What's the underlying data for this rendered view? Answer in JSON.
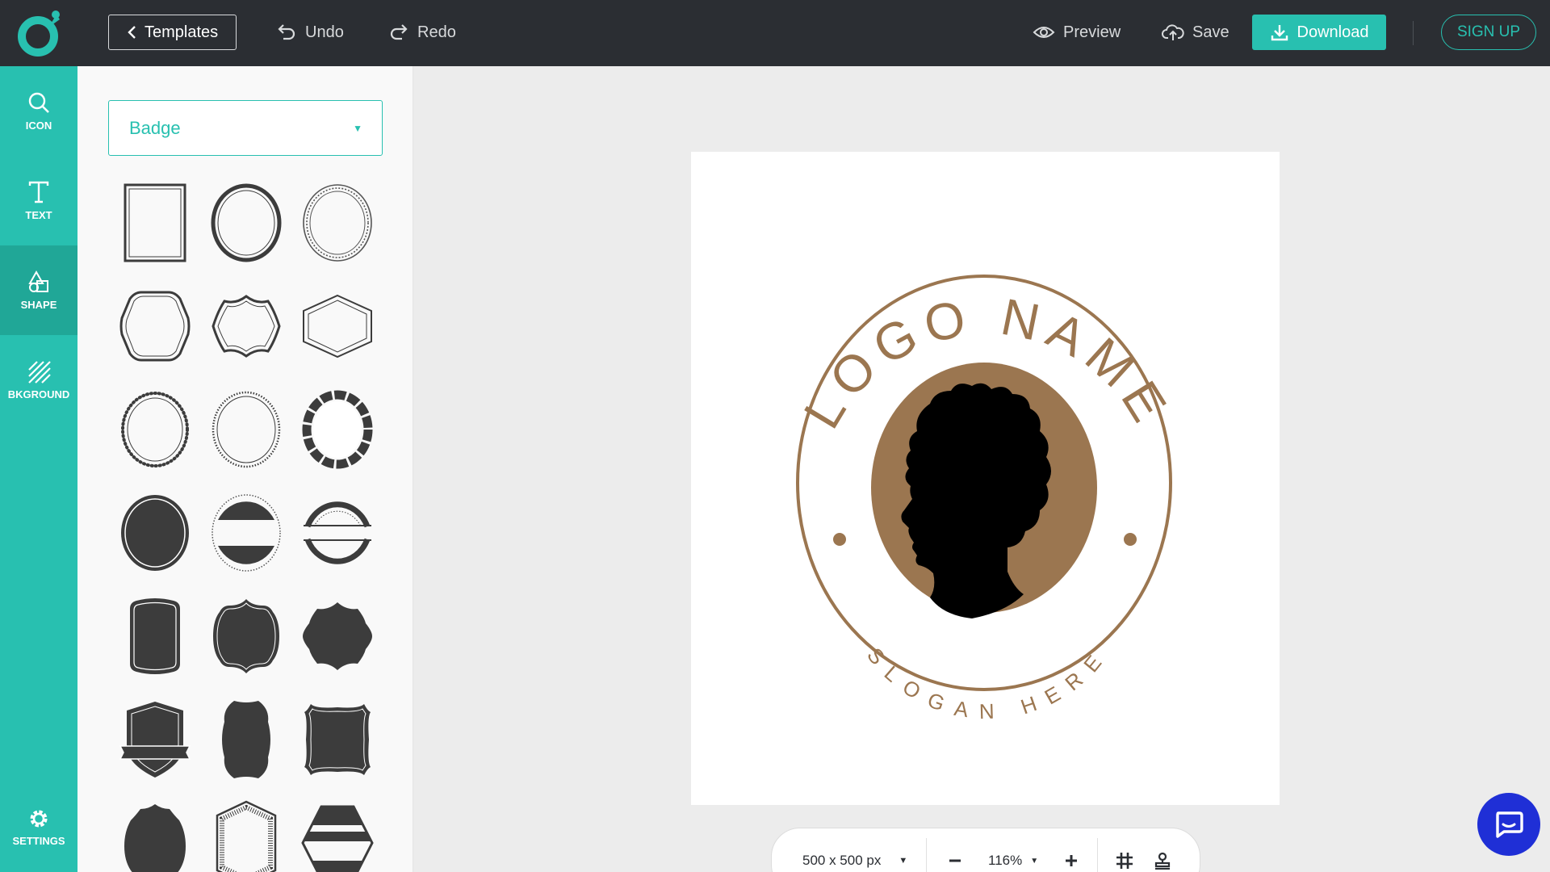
{
  "header": {
    "templates_label": "Templates",
    "undo_label": "Undo",
    "redo_label": "Redo",
    "preview_label": "Preview",
    "save_label": "Save",
    "download_label": "Download",
    "signup_label": "SIGN UP"
  },
  "sidebar": {
    "items": [
      {
        "label": "ICON",
        "icon": "search-icon"
      },
      {
        "label": "TEXT",
        "icon": "text-icon"
      },
      {
        "label": "SHAPE",
        "icon": "shapes-icon",
        "active": true
      },
      {
        "label": "BKGROUND",
        "icon": "background-icon"
      }
    ],
    "settings_label": "SETTINGS"
  },
  "panel": {
    "category_value": "Badge"
  },
  "canvas": {
    "logo_title": "LOGO NAME",
    "logo_slogan": "SLOGAN HERE",
    "accent_color": "#9b7650"
  },
  "zoombar": {
    "size_value": "500 x 500 px",
    "zoom_value": "116%"
  },
  "colors": {
    "brand": "#28c0b0",
    "topbar": "#2b2e33",
    "chat": "#1f2fd6"
  }
}
